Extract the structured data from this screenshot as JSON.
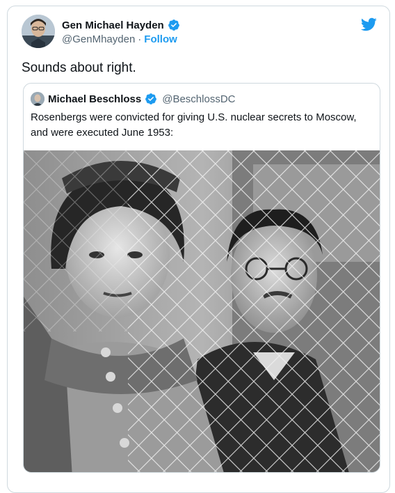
{
  "tweet": {
    "display_name": "Gen Michael Hayden",
    "handle": "@GenMhayden",
    "separator": "·",
    "follow_label": "Follow",
    "text": "Sounds about right."
  },
  "quoted": {
    "display_name": "Michael Beschloss",
    "handle": "@BeschlossDC",
    "text": "Rosenbergs were convicted for giving U.S. nuclear secrets to Moscow, and were executed June 1953:"
  },
  "icons": {
    "verified": "verified-badge-icon",
    "brand": "twitter-bird-icon"
  },
  "colors": {
    "accent": "#1d9bf0",
    "secondary_text": "#536471",
    "border": "#cfd9de"
  }
}
